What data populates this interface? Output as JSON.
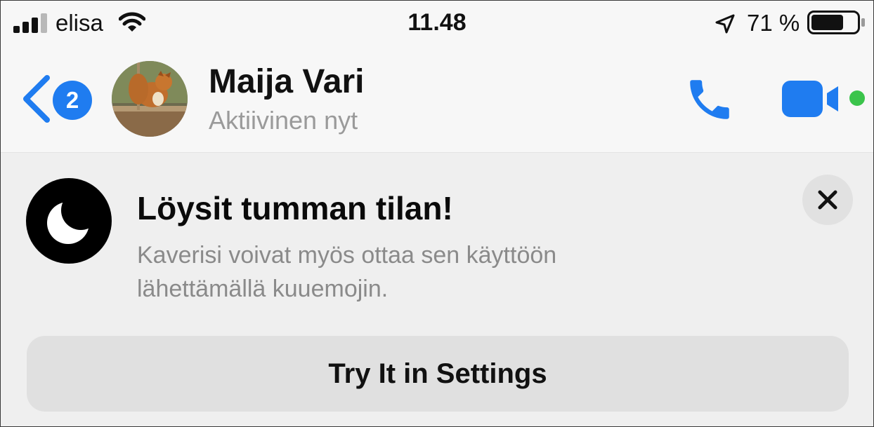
{
  "status_bar": {
    "carrier": "elisa",
    "time": "11.48",
    "battery_percent": "71 %",
    "battery_level": 0.71
  },
  "header": {
    "unread_count": "2",
    "contact_name": "Maija Vari",
    "presence": "Aktiivinen nyt",
    "accent_color": "#1f7cf0",
    "online_color": "#3bc44b"
  },
  "banner": {
    "title": "Löysit tumman tilan!",
    "description": "Kaverisi voivat myös ottaa sen käyttöön lähettämällä kuuemojin.",
    "cta_label": "Try It in Settings"
  },
  "icons": {
    "signal": "signal-bars-icon",
    "wifi": "wifi-icon",
    "location": "location-arrow-icon",
    "battery": "battery-icon",
    "back": "chevron-left-icon",
    "phone": "phone-icon",
    "video": "video-camera-icon",
    "moon": "moon-icon",
    "close": "close-icon"
  }
}
